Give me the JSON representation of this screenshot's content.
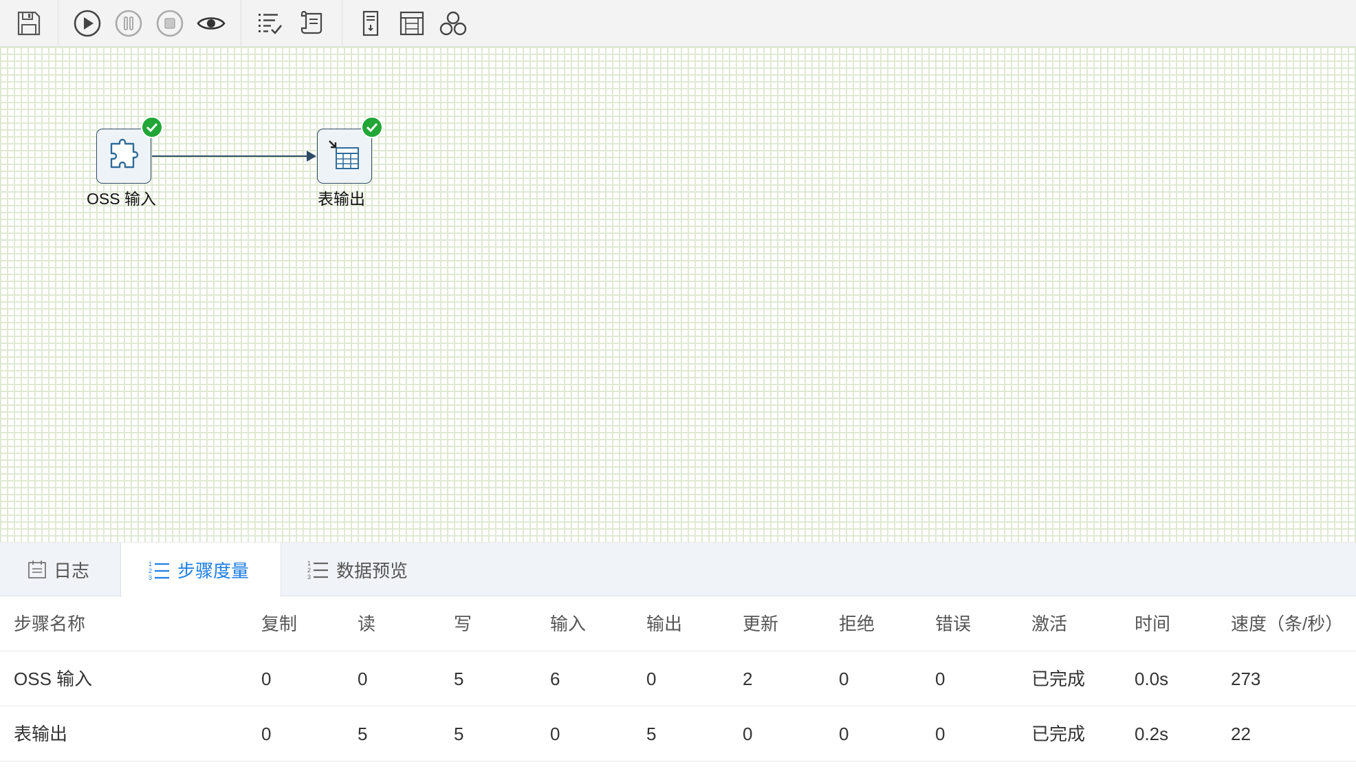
{
  "toolbar": {
    "buttons": [
      {
        "icon": "save-icon"
      },
      {
        "icon": "run-icon"
      },
      {
        "icon": "pause-icon"
      },
      {
        "icon": "stop-icon"
      },
      {
        "icon": "preview-icon"
      },
      {
        "icon": "checklist-icon"
      },
      {
        "icon": "script-icon"
      },
      {
        "icon": "document-icon"
      },
      {
        "icon": "sql-icon"
      },
      {
        "icon": "cluster-icon"
      }
    ]
  },
  "canvas": {
    "steps": [
      {
        "label": "OSS 输入",
        "icon": "puzzle-icon",
        "status": "success"
      },
      {
        "label": "表输出",
        "icon": "table-output-icon",
        "status": "success"
      }
    ]
  },
  "tabs": [
    {
      "label": "日志",
      "icon": "calendar-icon",
      "active": false
    },
    {
      "label": "步骤度量",
      "icon": "numbered-list-icon",
      "active": true
    },
    {
      "label": "数据预览",
      "icon": "numbered-list-icon",
      "active": false
    }
  ],
  "table": {
    "headers": [
      "步骤名称",
      "复制",
      "读",
      "写",
      "输入",
      "输出",
      "更新",
      "拒绝",
      "错误",
      "激活",
      "时间",
      "速度（条/秒）"
    ],
    "rows": [
      [
        "OSS 输入",
        "0",
        "0",
        "5",
        "6",
        "0",
        "2",
        "0",
        "0",
        "已完成",
        "0.0s",
        "273"
      ],
      [
        "表输出",
        "0",
        "5",
        "5",
        "0",
        "5",
        "0",
        "0",
        "0",
        "已完成",
        "0.2s",
        "22"
      ]
    ]
  },
  "colors": {
    "accent": "#1e7ee6",
    "success": "#21a637",
    "node_border": "#2d4a63",
    "grid": "#dfe9d2"
  }
}
